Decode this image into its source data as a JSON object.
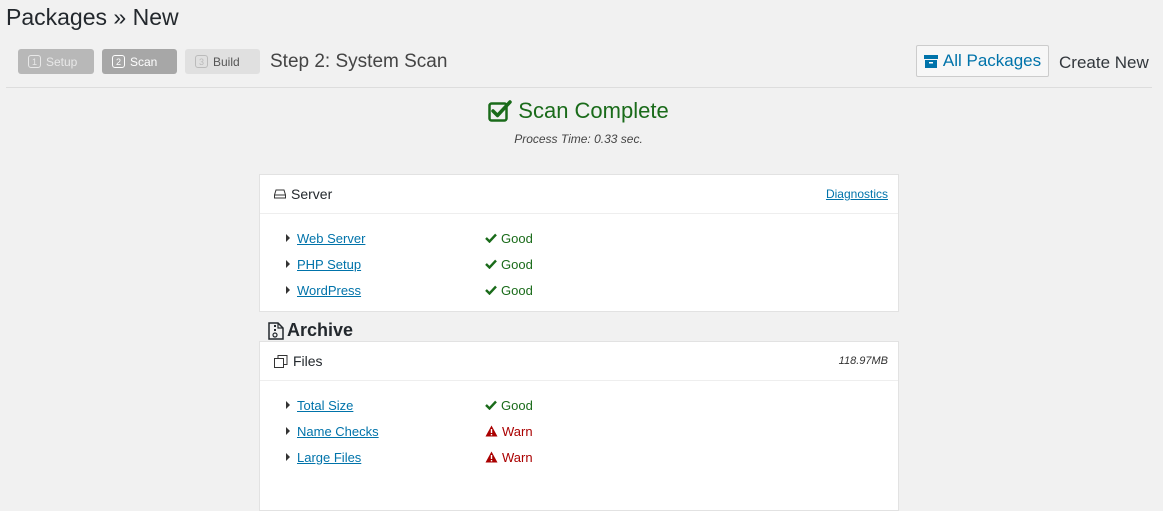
{
  "page": {
    "title": "Packages » New"
  },
  "steps": [
    {
      "num": "1",
      "label": "Setup"
    },
    {
      "num": "2",
      "label": "Scan"
    },
    {
      "num": "3",
      "label": "Build"
    }
  ],
  "step_title": "Step 2: System Scan",
  "actions": {
    "all_packages": "All Packages",
    "create_new": "Create New"
  },
  "scan": {
    "title": "Scan Complete",
    "process_time": "Process Time: 0.33 sec."
  },
  "server": {
    "title": "Server",
    "link": "Diagnostics",
    "rows": [
      {
        "label": "Web Server",
        "status": "Good"
      },
      {
        "label": "PHP Setup",
        "status": "Good"
      },
      {
        "label": "WordPress",
        "status": "Good"
      }
    ]
  },
  "archive": {
    "title": "Archive",
    "files": {
      "title": "Files",
      "size": "118.97MB",
      "rows": [
        {
          "label": "Total Size",
          "status": "Good"
        },
        {
          "label": "Name Checks",
          "status": "Warn"
        },
        {
          "label": "Large Files",
          "status": "Warn"
        }
      ]
    }
  },
  "colors": {
    "good": "#1a6b1a",
    "warn": "#aa0000",
    "link": "#0073aa"
  }
}
